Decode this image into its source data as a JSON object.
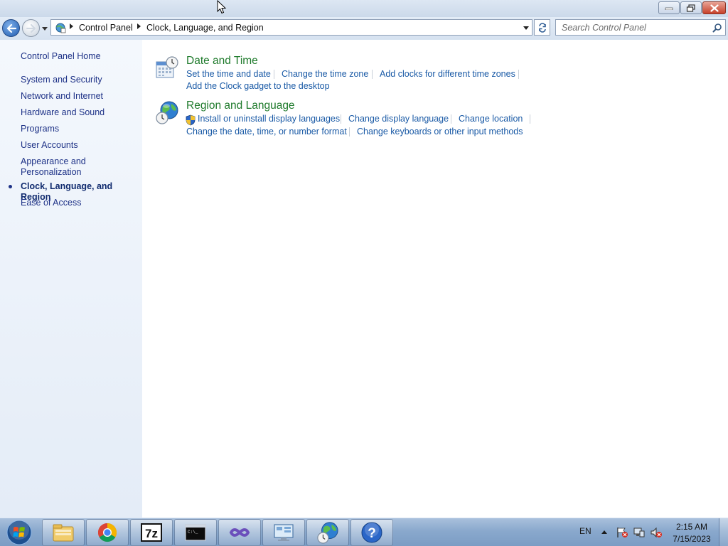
{
  "window": {
    "controls": {
      "minimize": "minimize",
      "maximize": "restore",
      "close": "close"
    }
  },
  "address_bar": {
    "breadcrumbs": [
      "Control Panel",
      "Clock, Language, and Region"
    ],
    "search_placeholder": "Search Control Panel"
  },
  "sidebar": {
    "home": "Control Panel Home",
    "items": [
      {
        "label": "System and Security",
        "selected": false
      },
      {
        "label": "Network and Internet",
        "selected": false
      },
      {
        "label": "Hardware and Sound",
        "selected": false
      },
      {
        "label": "Programs",
        "selected": false
      },
      {
        "label": "User Accounts",
        "selected": false
      },
      {
        "label": "Appearance and",
        "label2": "Personalization",
        "selected": false
      },
      {
        "label": "Clock, Language, and Region",
        "selected": true
      },
      {
        "label": "Ease of Access",
        "selected": false
      }
    ]
  },
  "categories": [
    {
      "title": "Date and Time",
      "icon": "calendar-clock-icon",
      "links": [
        "Set the time and date",
        "Change the time zone",
        "Add clocks for different time zones",
        "Add the Clock gadget to the desktop"
      ]
    },
    {
      "title": "Region and Language",
      "icon": "globe-clock-icon",
      "links": [
        "Install or uninstall display languages",
        "Change display language",
        "Change location",
        "Change the date, time, or number format",
        "Change keyboards or other input methods"
      ]
    }
  ],
  "taskbar": {
    "pinned": [
      "windows-explorer",
      "google-chrome",
      "7-zip",
      "command-prompt",
      "visual-studio",
      "control-panel-devices",
      "region-and-language",
      "help-and-support"
    ],
    "tray": {
      "language": "EN",
      "time": "2:15 AM",
      "date": "7/15/2023"
    }
  },
  "colors": {
    "link": "#1a5aa6",
    "category_title": "#1e7a2b",
    "nav_text": "#1e3287"
  }
}
